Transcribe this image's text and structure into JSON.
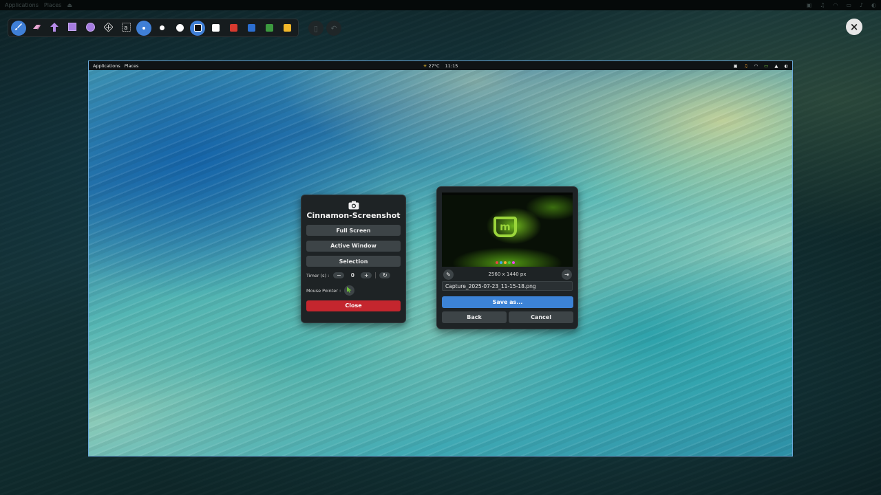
{
  "top_panel": {
    "applications": "Applications",
    "places": "Places"
  },
  "toolbar": {
    "tools": [
      {
        "name": "brush-tool",
        "glyph": "✎"
      },
      {
        "name": "eraser-tool",
        "glyph": "⌫"
      },
      {
        "name": "arrow-tool",
        "glyph": "⬆"
      },
      {
        "name": "rectangle-tool",
        "glyph": "■"
      },
      {
        "name": "ellipse-tool",
        "glyph": "●"
      },
      {
        "name": "blur-tool",
        "glyph": "▦"
      },
      {
        "name": "text-tool",
        "glyph": "a"
      }
    ],
    "sizes": [
      "small",
      "medium",
      "large"
    ],
    "colors": [
      {
        "name": "black",
        "hex": "#111111"
      },
      {
        "name": "white",
        "hex": "#ffffff"
      },
      {
        "name": "red",
        "hex": "#d63a2f"
      },
      {
        "name": "blue",
        "hex": "#2c6fd1"
      },
      {
        "name": "green",
        "hex": "#3c9a3f"
      },
      {
        "name": "yellow",
        "hex": "#f1b72a"
      }
    ]
  },
  "captured_screen": {
    "panel": {
      "applications": "Applications",
      "places": "Places",
      "weather": "27°C",
      "time": "11:15"
    }
  },
  "screenshot_dialog": {
    "title": "Cinnamon-Screenshot",
    "full_screen": "Full Screen",
    "active_window": "Active Window",
    "selection": "Selection",
    "timer_label": "Timer (s) :",
    "timer_value": "0",
    "mouse_pointer_label": "Mouse Pointer :",
    "close": "Close"
  },
  "save_dialog": {
    "dimensions": "2560 x 1440 px",
    "filename": "Capture_2025-07-23_11-15-18.png",
    "save_as": "Save as...",
    "back": "Back",
    "cancel": "Cancel"
  },
  "colors": {
    "accent": "#3c83d6",
    "danger": "#c4262e"
  }
}
